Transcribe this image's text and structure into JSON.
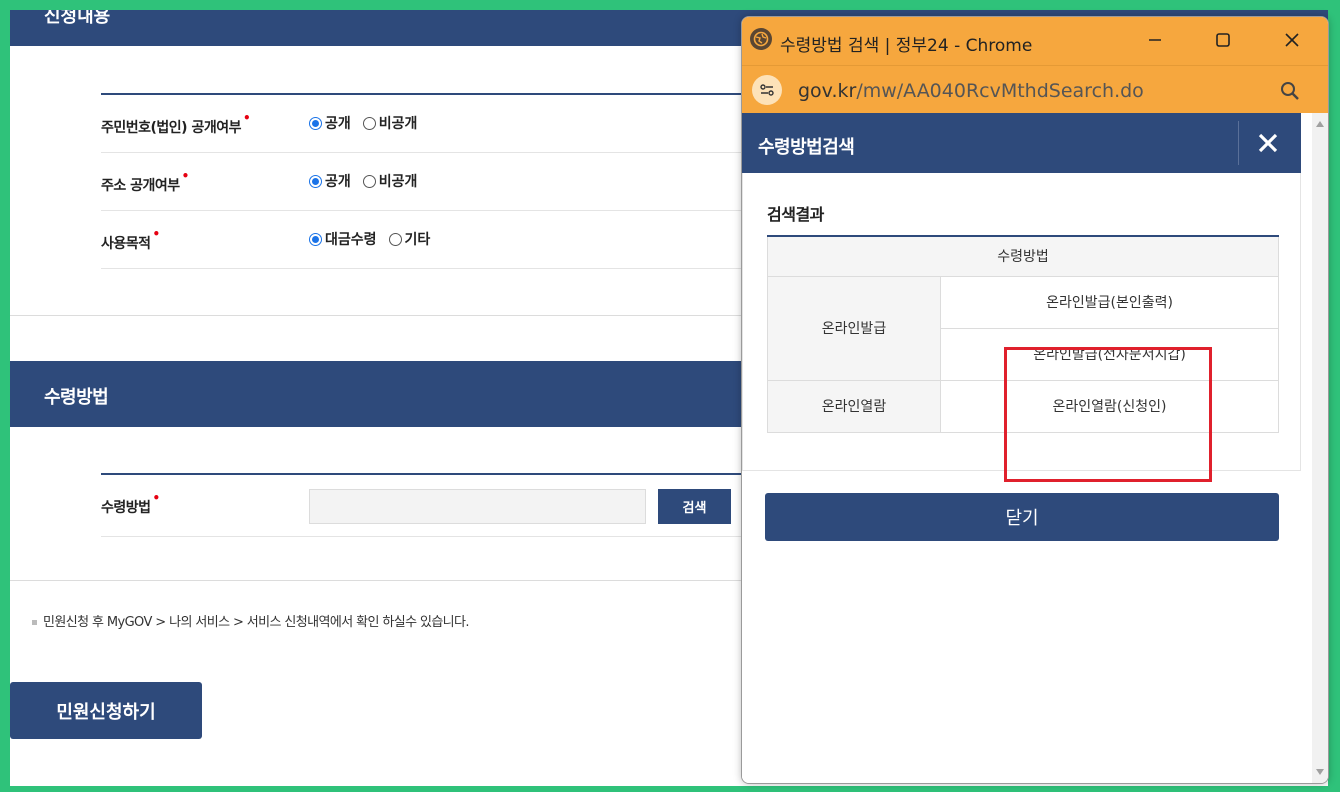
{
  "main": {
    "top_band_title": "신청내용",
    "rows": [
      {
        "label": "주민번호(법인) 공개여부",
        "options": [
          {
            "label": "공개",
            "checked": true
          },
          {
            "label": "비공개",
            "checked": false
          }
        ]
      },
      {
        "label": "주소 공개여부",
        "options": [
          {
            "label": "공개",
            "checked": true
          },
          {
            "label": "비공개",
            "checked": false
          }
        ]
      },
      {
        "label": "사용목적",
        "options": [
          {
            "label": "대금수령",
            "checked": true
          },
          {
            "label": "기타",
            "checked": false
          }
        ]
      }
    ],
    "section_title": "수령방법",
    "method_label": "수령방법",
    "method_value": "",
    "search_button": "검색",
    "note": "민원신청 후 MyGOV > 나의 서비스 > 서비스 신청내역에서 확인 하실수 있습니다.",
    "apply_button": "민원신청하기",
    "required_mark": "•"
  },
  "popup": {
    "window_title": "수령방법 검색 | 정부24 - Chrome",
    "url_host": "gov.kr",
    "url_path": "/mw/AA040RcvMthdSearch.do",
    "header_title": "수령방법검색",
    "result_title": "검색결과",
    "table_header": "수령방법",
    "groups": [
      {
        "name": "온라인발급",
        "items": [
          "온라인발급(본인출력)",
          "온라인발급(전자문서지갑)"
        ]
      },
      {
        "name": "온라인열람",
        "items": [
          "온라인열람(신청인)"
        ]
      }
    ],
    "close_button": "닫기",
    "colors": {
      "titlebar": "#f6a73e",
      "brand": "#2e4a7b",
      "highlight": "#e0202c"
    }
  }
}
